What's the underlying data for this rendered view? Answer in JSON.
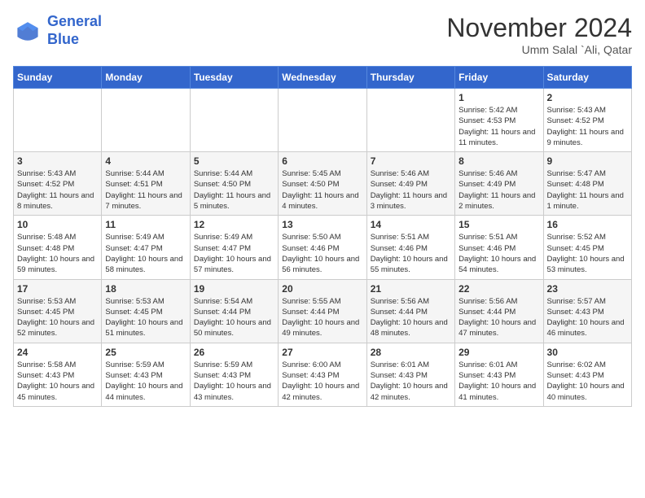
{
  "logo": {
    "line1": "General",
    "line2": "Blue"
  },
  "title": "November 2024",
  "subtitle": "Umm Salal `Ali, Qatar",
  "headers": [
    "Sunday",
    "Monday",
    "Tuesday",
    "Wednesday",
    "Thursday",
    "Friday",
    "Saturday"
  ],
  "rows": [
    [
      {
        "day": "",
        "info": ""
      },
      {
        "day": "",
        "info": ""
      },
      {
        "day": "",
        "info": ""
      },
      {
        "day": "",
        "info": ""
      },
      {
        "day": "",
        "info": ""
      },
      {
        "day": "1",
        "info": "Sunrise: 5:42 AM\nSunset: 4:53 PM\nDaylight: 11 hours and 11 minutes."
      },
      {
        "day": "2",
        "info": "Sunrise: 5:43 AM\nSunset: 4:52 PM\nDaylight: 11 hours and 9 minutes."
      }
    ],
    [
      {
        "day": "3",
        "info": "Sunrise: 5:43 AM\nSunset: 4:52 PM\nDaylight: 11 hours and 8 minutes."
      },
      {
        "day": "4",
        "info": "Sunrise: 5:44 AM\nSunset: 4:51 PM\nDaylight: 11 hours and 7 minutes."
      },
      {
        "day": "5",
        "info": "Sunrise: 5:44 AM\nSunset: 4:50 PM\nDaylight: 11 hours and 5 minutes."
      },
      {
        "day": "6",
        "info": "Sunrise: 5:45 AM\nSunset: 4:50 PM\nDaylight: 11 hours and 4 minutes."
      },
      {
        "day": "7",
        "info": "Sunrise: 5:46 AM\nSunset: 4:49 PM\nDaylight: 11 hours and 3 minutes."
      },
      {
        "day": "8",
        "info": "Sunrise: 5:46 AM\nSunset: 4:49 PM\nDaylight: 11 hours and 2 minutes."
      },
      {
        "day": "9",
        "info": "Sunrise: 5:47 AM\nSunset: 4:48 PM\nDaylight: 11 hours and 1 minute."
      }
    ],
    [
      {
        "day": "10",
        "info": "Sunrise: 5:48 AM\nSunset: 4:48 PM\nDaylight: 10 hours and 59 minutes."
      },
      {
        "day": "11",
        "info": "Sunrise: 5:49 AM\nSunset: 4:47 PM\nDaylight: 10 hours and 58 minutes."
      },
      {
        "day": "12",
        "info": "Sunrise: 5:49 AM\nSunset: 4:47 PM\nDaylight: 10 hours and 57 minutes."
      },
      {
        "day": "13",
        "info": "Sunrise: 5:50 AM\nSunset: 4:46 PM\nDaylight: 10 hours and 56 minutes."
      },
      {
        "day": "14",
        "info": "Sunrise: 5:51 AM\nSunset: 4:46 PM\nDaylight: 10 hours and 55 minutes."
      },
      {
        "day": "15",
        "info": "Sunrise: 5:51 AM\nSunset: 4:46 PM\nDaylight: 10 hours and 54 minutes."
      },
      {
        "day": "16",
        "info": "Sunrise: 5:52 AM\nSunset: 4:45 PM\nDaylight: 10 hours and 53 minutes."
      }
    ],
    [
      {
        "day": "17",
        "info": "Sunrise: 5:53 AM\nSunset: 4:45 PM\nDaylight: 10 hours and 52 minutes."
      },
      {
        "day": "18",
        "info": "Sunrise: 5:53 AM\nSunset: 4:45 PM\nDaylight: 10 hours and 51 minutes."
      },
      {
        "day": "19",
        "info": "Sunrise: 5:54 AM\nSunset: 4:44 PM\nDaylight: 10 hours and 50 minutes."
      },
      {
        "day": "20",
        "info": "Sunrise: 5:55 AM\nSunset: 4:44 PM\nDaylight: 10 hours and 49 minutes."
      },
      {
        "day": "21",
        "info": "Sunrise: 5:56 AM\nSunset: 4:44 PM\nDaylight: 10 hours and 48 minutes."
      },
      {
        "day": "22",
        "info": "Sunrise: 5:56 AM\nSunset: 4:44 PM\nDaylight: 10 hours and 47 minutes."
      },
      {
        "day": "23",
        "info": "Sunrise: 5:57 AM\nSunset: 4:43 PM\nDaylight: 10 hours and 46 minutes."
      }
    ],
    [
      {
        "day": "24",
        "info": "Sunrise: 5:58 AM\nSunset: 4:43 PM\nDaylight: 10 hours and 45 minutes."
      },
      {
        "day": "25",
        "info": "Sunrise: 5:59 AM\nSunset: 4:43 PM\nDaylight: 10 hours and 44 minutes."
      },
      {
        "day": "26",
        "info": "Sunrise: 5:59 AM\nSunset: 4:43 PM\nDaylight: 10 hours and 43 minutes."
      },
      {
        "day": "27",
        "info": "Sunrise: 6:00 AM\nSunset: 4:43 PM\nDaylight: 10 hours and 42 minutes."
      },
      {
        "day": "28",
        "info": "Sunrise: 6:01 AM\nSunset: 4:43 PM\nDaylight: 10 hours and 42 minutes."
      },
      {
        "day": "29",
        "info": "Sunrise: 6:01 AM\nSunset: 4:43 PM\nDaylight: 10 hours and 41 minutes."
      },
      {
        "day": "30",
        "info": "Sunrise: 6:02 AM\nSunset: 4:43 PM\nDaylight: 10 hours and 40 minutes."
      }
    ]
  ]
}
